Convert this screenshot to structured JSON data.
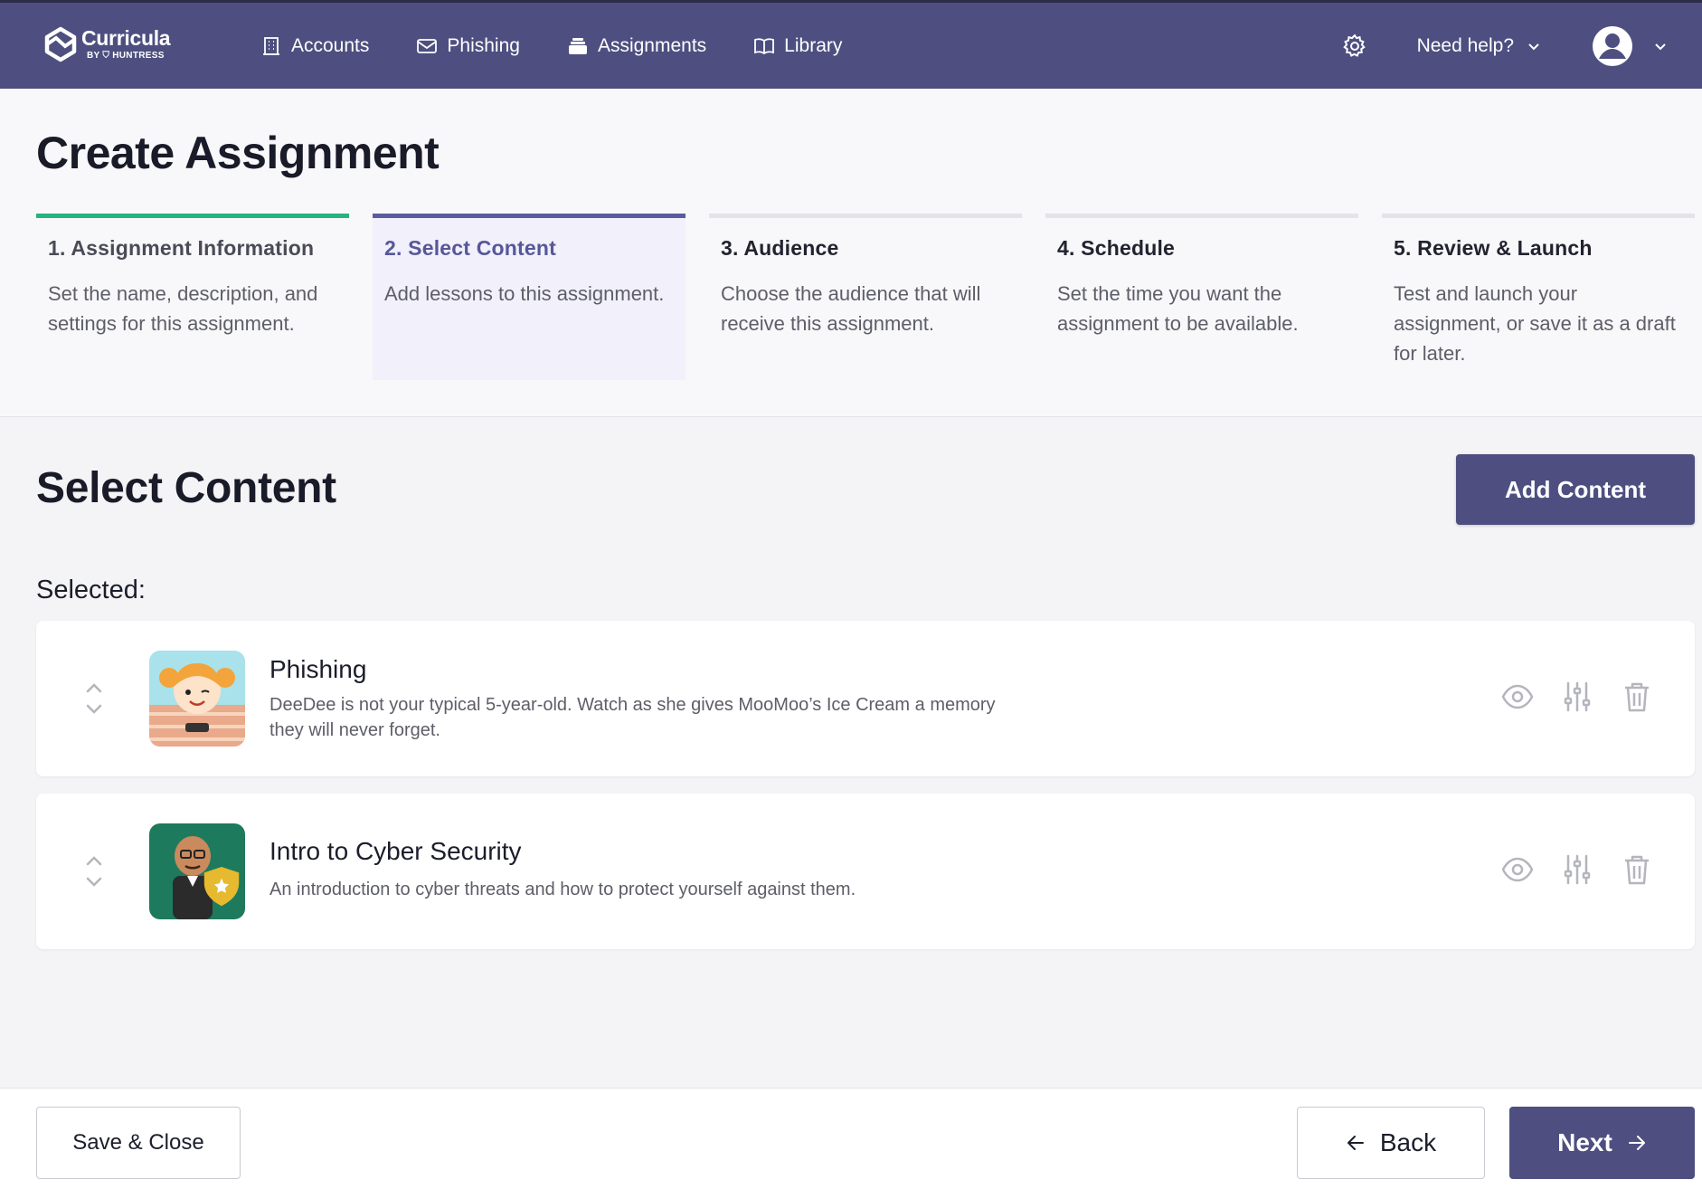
{
  "app": {
    "logo_name": "Curricula",
    "logo_sub": "BY ⛉ HUNTRESS"
  },
  "nav": {
    "items": [
      {
        "label": "Accounts",
        "icon": "building-icon"
      },
      {
        "label": "Phishing",
        "icon": "envelope-icon"
      },
      {
        "label": "Assignments",
        "icon": "stack-icon"
      },
      {
        "label": "Library",
        "icon": "book-icon"
      }
    ],
    "help_label": "Need help?"
  },
  "page": {
    "title": "Create Assignment"
  },
  "steps": [
    {
      "title": "1. Assignment Information",
      "description": "Set the name, description, and settings for this assignment.",
      "state": "complete"
    },
    {
      "title": "2. Select Content",
      "description": "Add lessons to this assignment.",
      "state": "active"
    },
    {
      "title": "3. Audience",
      "description": "Choose the audience that will receive this assignment.",
      "state": "upcoming"
    },
    {
      "title": "4. Schedule",
      "description": "Set the time you want the assignment to be available.",
      "state": "upcoming"
    },
    {
      "title": "5. Review & Launch",
      "description": "Test and launch your assignment, or save it as a draft for later.",
      "state": "upcoming"
    }
  ],
  "content": {
    "title": "Select Content",
    "add_label": "Add Content",
    "selected_label": "Selected:",
    "items": [
      {
        "title": "Phishing",
        "description": "DeeDee is not your typical 5-year-old. Watch as she gives MooMoo’s Ice Cream a memory they will never forget."
      },
      {
        "title": "Intro to Cyber Security",
        "description": "An introduction to cyber threats and how to protect yourself against them."
      }
    ]
  },
  "footer": {
    "save_label": "Save & Close",
    "back_label": "Back",
    "next_label": "Next"
  },
  "colors": {
    "brand": "#4e4f80",
    "complete": "#27b47e",
    "active_step": "#5b5ca0"
  }
}
